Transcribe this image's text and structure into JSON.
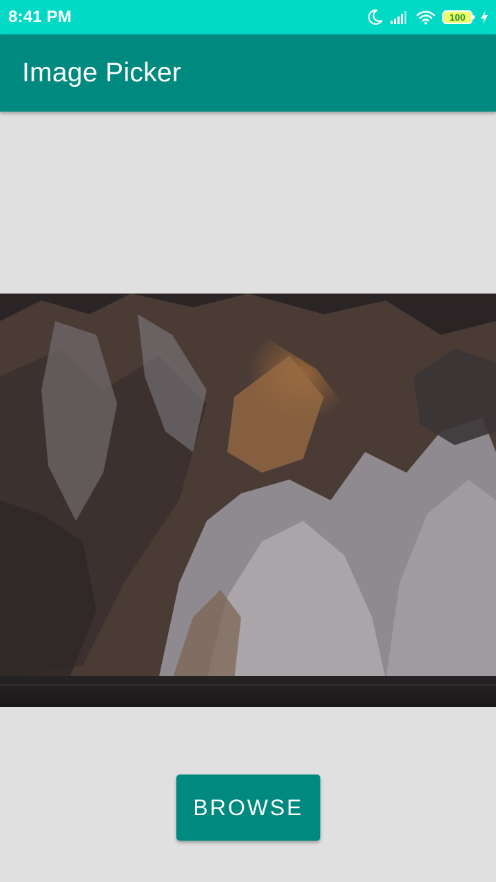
{
  "status_bar": {
    "time": "8:41 PM",
    "battery_level": "100",
    "icons": [
      "moon-icon",
      "signal-icon",
      "wifi-icon",
      "battery-icon",
      "charging-icon"
    ],
    "background_color": "#00d9c5"
  },
  "app_bar": {
    "title": "Image Picker",
    "background_color": "#00897f"
  },
  "main": {
    "browse_label": "BROWSE"
  },
  "colors": {
    "accent": "#00897f",
    "background": "#e0e0e0"
  }
}
